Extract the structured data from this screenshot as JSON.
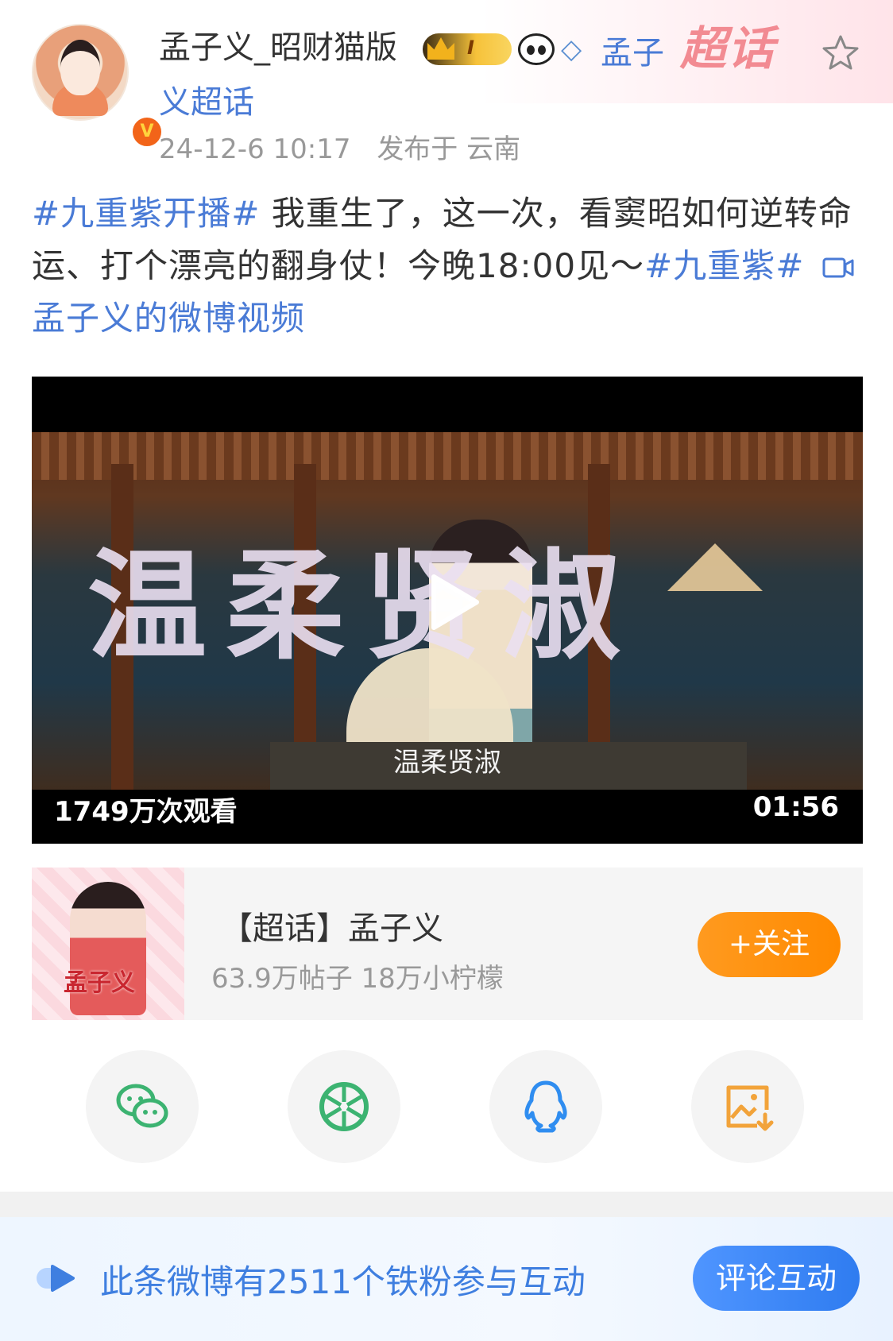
{
  "post": {
    "username": "孟子义_昭财猫版",
    "topic_link_line1": "孟子",
    "topic_link_line2": "义超话",
    "chaohua_deco": "超话",
    "level_badge": "I",
    "timestamp": "24-12-6 10:17",
    "location": "发布于 云南",
    "text": {
      "hashtag1": "#九重紫开播#",
      "body": " 我重生了，这一次，看窦昭如何逆转命运、打个漂亮的翻身仗！今晚18:00见～",
      "hashtag2": "#九重紫#",
      "video_link": " 孟子义的微博视频"
    }
  },
  "video": {
    "overlay_title": "温柔贤淑",
    "subtitle": "温柔贤淑",
    "view_count": "1749万次观看",
    "duration": "01:56"
  },
  "topic_card": {
    "thumb_text": "孟子义",
    "title": "【超话】孟子义",
    "stats": "63.9万帖子 18万小柠檬",
    "follow_label": "+关注"
  },
  "share": [
    "wechat-icon",
    "moments-icon",
    "qq-icon",
    "save-image-icon"
  ],
  "bottom": {
    "fans_text": "此条微博有2511个铁粉参与互动",
    "comment_label": "评论互动"
  },
  "colors": {
    "link_blue": "#4a7bd6",
    "follow_orange": "#ff9a1f",
    "comment_blue": "#3f7fe0"
  }
}
